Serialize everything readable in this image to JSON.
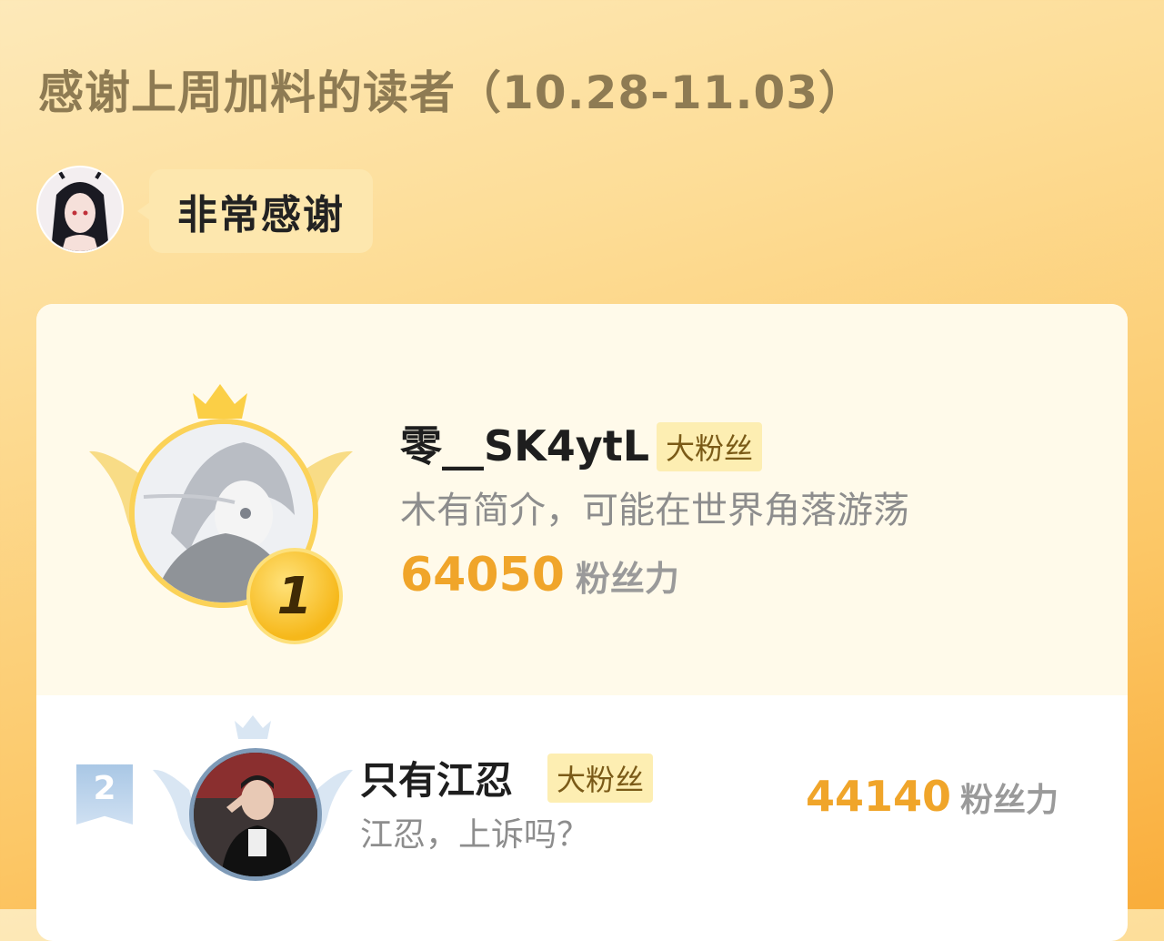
{
  "header": {
    "title": "感谢上周加料的读者（10.28-11.03）"
  },
  "author": {
    "avatar_icon": "author-avatar-girl",
    "message": "非常感谢"
  },
  "ranking": [
    {
      "rank": "1",
      "name": "零__SK4ytL",
      "badge": "大粉丝",
      "description": "木有简介，可能在世界角落游荡",
      "score": "64050",
      "score_unit": "粉丝力",
      "decor_icons": [
        "crown-icon",
        "wings-icon",
        "medal-icon"
      ]
    },
    {
      "rank": "2",
      "name": "只有江忍",
      "badge": "大粉丝",
      "description": "江忍，上诉吗？",
      "score": "44140",
      "score_unit": "粉丝力",
      "decor_icons": [
        "crown-icon",
        "wings-icon",
        "rank-flag-icon"
      ]
    }
  ],
  "colors": {
    "title": "#8e7b53",
    "score": "#f0a52a",
    "gold": "#fbd258",
    "silver": "#7f9bb8"
  }
}
